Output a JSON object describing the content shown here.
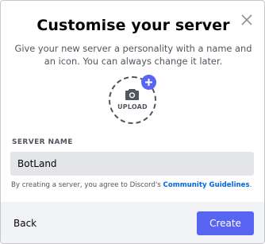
{
  "modal": {
    "title": "Customise your server",
    "subtitle": "Give your new server a personality with a name and an icon. You can always change it later.",
    "close_icon": "close-icon"
  },
  "upload": {
    "label": "UPLOAD",
    "icon": "camera-icon",
    "badge_icon": "plus-icon"
  },
  "server_name": {
    "label": "SERVER NAME",
    "value": "BotLand"
  },
  "terms": {
    "prefix": "By creating a server, you agree to Discord's ",
    "link": "Community Guidelines",
    "suffix": "."
  },
  "footer": {
    "back_label": "Back",
    "create_label": "Create"
  },
  "colors": {
    "accent": "#5865f2",
    "link": "#0068e0",
    "footer_bg": "#f2f3f5",
    "input_bg": "#e3e5e8"
  }
}
